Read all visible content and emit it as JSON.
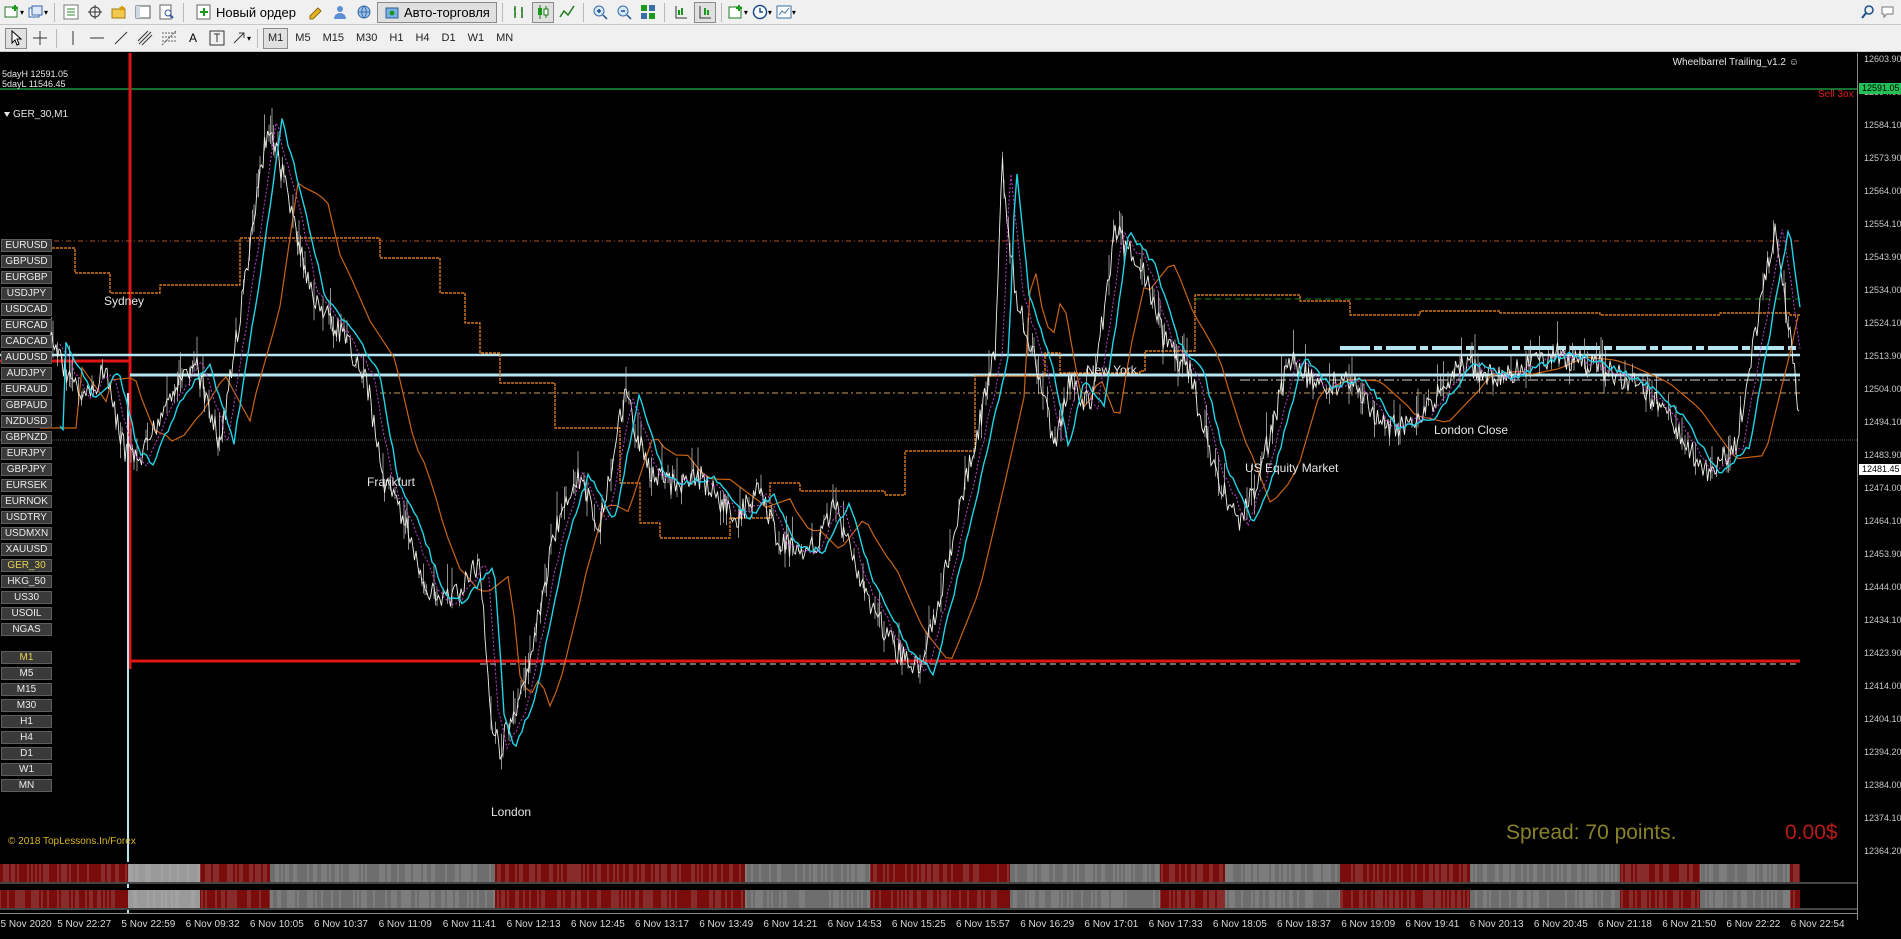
{
  "toolbar": {
    "new_order_label": "Новый ордер",
    "autotrading_label": "Авто-торговля",
    "timeframes": [
      "M1",
      "M5",
      "M15",
      "M30",
      "H1",
      "H4",
      "D1",
      "W1",
      "MN"
    ],
    "active_timeframe": "M1"
  },
  "chart": {
    "symbol_title": "GER_30,M1",
    "indicator_name": "Wheelbarrel Trailing_v1.2",
    "five_day_high": "5dayH 12591.05",
    "five_day_low": "5dayL 11546.45",
    "sell_label": "Sell 3ox",
    "copyright": "© 2018 TopLessons.In/Forex",
    "spread_text": "Spread: 70 points.",
    "profit_text": "0.00$",
    "colors": {
      "background": "#000000",
      "price_line": "#ffffff",
      "ma_cyan": "#22d3e6",
      "ma_orange": "#c86414",
      "stop_orange": "#ff8c1a",
      "high_line": "#22e060",
      "low_line": "#e01414",
      "session_line": "#b4e4f0"
    }
  },
  "sessions": [
    "Sydney",
    "Frankfurt",
    "London",
    "New York",
    "US Equity Market",
    "London Close"
  ],
  "symbols": [
    "EURUSD",
    "GBPUSD",
    "EURGBP",
    "USDJPY",
    "USDCAD",
    "EURCAD",
    "CADCAD",
    "AUDUSD",
    "AUDJPY",
    "EURAUD",
    "GBPAUD",
    "NZDUSD",
    "GBPNZD",
    "EURJPY",
    "GBPJPY",
    "EURSEK",
    "EURNOK",
    "USDTRY",
    "USDMXN",
    "XAUUSD",
    "GER_30",
    "HKG_50",
    "US30",
    "USOIL",
    "NGAS"
  ],
  "active_symbol": "GER_30",
  "tf_buttons": [
    "M1",
    "M5",
    "M15",
    "M30",
    "H1",
    "H4",
    "D1",
    "W1",
    "MN"
  ],
  "price_axis": {
    "ticks": [
      "12603.90",
      "12594.00",
      "12584.10",
      "12573.90",
      "12564.00",
      "12554.10",
      "12543.90",
      "12534.00",
      "12524.10",
      "12513.90",
      "12504.00",
      "12494.10",
      "12483.90",
      "12474.00",
      "12464.10",
      "12453.90",
      "12444.00",
      "12434.10",
      "12423.90",
      "12414.00",
      "12404.10",
      "12394.20",
      "12384.00",
      "12374.10",
      "12364.20"
    ],
    "high_badge": "12591.05",
    "current_badge": "12481.45"
  },
  "time_axis": [
    "5 Nov 2020",
    "5 Nov 22:27",
    "5 Nov 22:59",
    "6 Nov 09:32",
    "6 Nov 10:05",
    "6 Nov 10:37",
    "6 Nov 11:09",
    "6 Nov 11:41",
    "6 Nov 12:13",
    "6 Nov 12:45",
    "6 Nov 13:17",
    "6 Nov 13:49",
    "6 Nov 14:21",
    "6 Nov 14:53",
    "6 Nov 15:25",
    "6 Nov 15:57",
    "6 Nov 16:29",
    "6 Nov 17:01",
    "6 Nov 17:33",
    "6 Nov 18:05",
    "6 Nov 18:37",
    "6 Nov 19:09",
    "6 Nov 19:41",
    "6 Nov 20:13",
    "6 Nov 20:45",
    "6 Nov 21:18",
    "6 Nov 21:50",
    "6 Nov 22:22",
    "6 Nov 22:54"
  ],
  "strip_scale": [
    "2",
    "1",
    "0"
  ]
}
